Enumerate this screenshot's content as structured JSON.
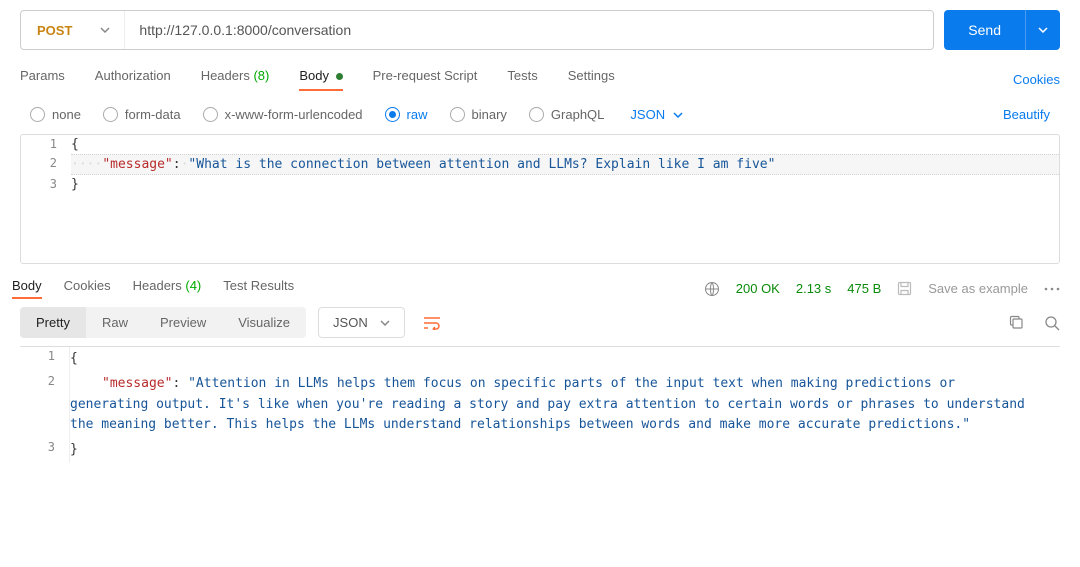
{
  "request": {
    "method": "POST",
    "url": "http://127.0.0.1:8000/conversation",
    "send_label": "Send"
  },
  "tabs": {
    "params": "Params",
    "authorization": "Authorization",
    "headers": "Headers",
    "headers_count": "(8)",
    "body": "Body",
    "prerequest": "Pre-request Script",
    "tests": "Tests",
    "settings": "Settings",
    "cookies_link": "Cookies"
  },
  "body_types": {
    "none": "none",
    "form_data": "form-data",
    "urlencoded": "x-www-form-urlencoded",
    "raw": "raw",
    "binary": "binary",
    "graphql": "GraphQL",
    "lang": "JSON",
    "beautify": "Beautify"
  },
  "request_body": {
    "key": "\"message\"",
    "value": "\"What is the connection between attention and LLMs? Explain like I am five\""
  },
  "response_tabs": {
    "body": "Body",
    "cookies": "Cookies",
    "headers": "Headers",
    "headers_count": "(4)",
    "test_results": "Test Results"
  },
  "response_status": {
    "code": "200 OK",
    "time": "2.13 s",
    "size": "475 B",
    "save_as": "Save as example"
  },
  "view_modes": {
    "pretty": "Pretty",
    "raw": "Raw",
    "preview": "Preview",
    "visualize": "Visualize",
    "format": "JSON"
  },
  "response_body": {
    "key": "\"message\"",
    "value": "\"Attention in LLMs helps them focus on specific parts of the input text when making predictions or generating output. It's like when you're reading a story and pay extra attention to certain words or phrases to understand the meaning better. This helps the LLMs understand relationships between words and make more accurate predictions.\""
  }
}
